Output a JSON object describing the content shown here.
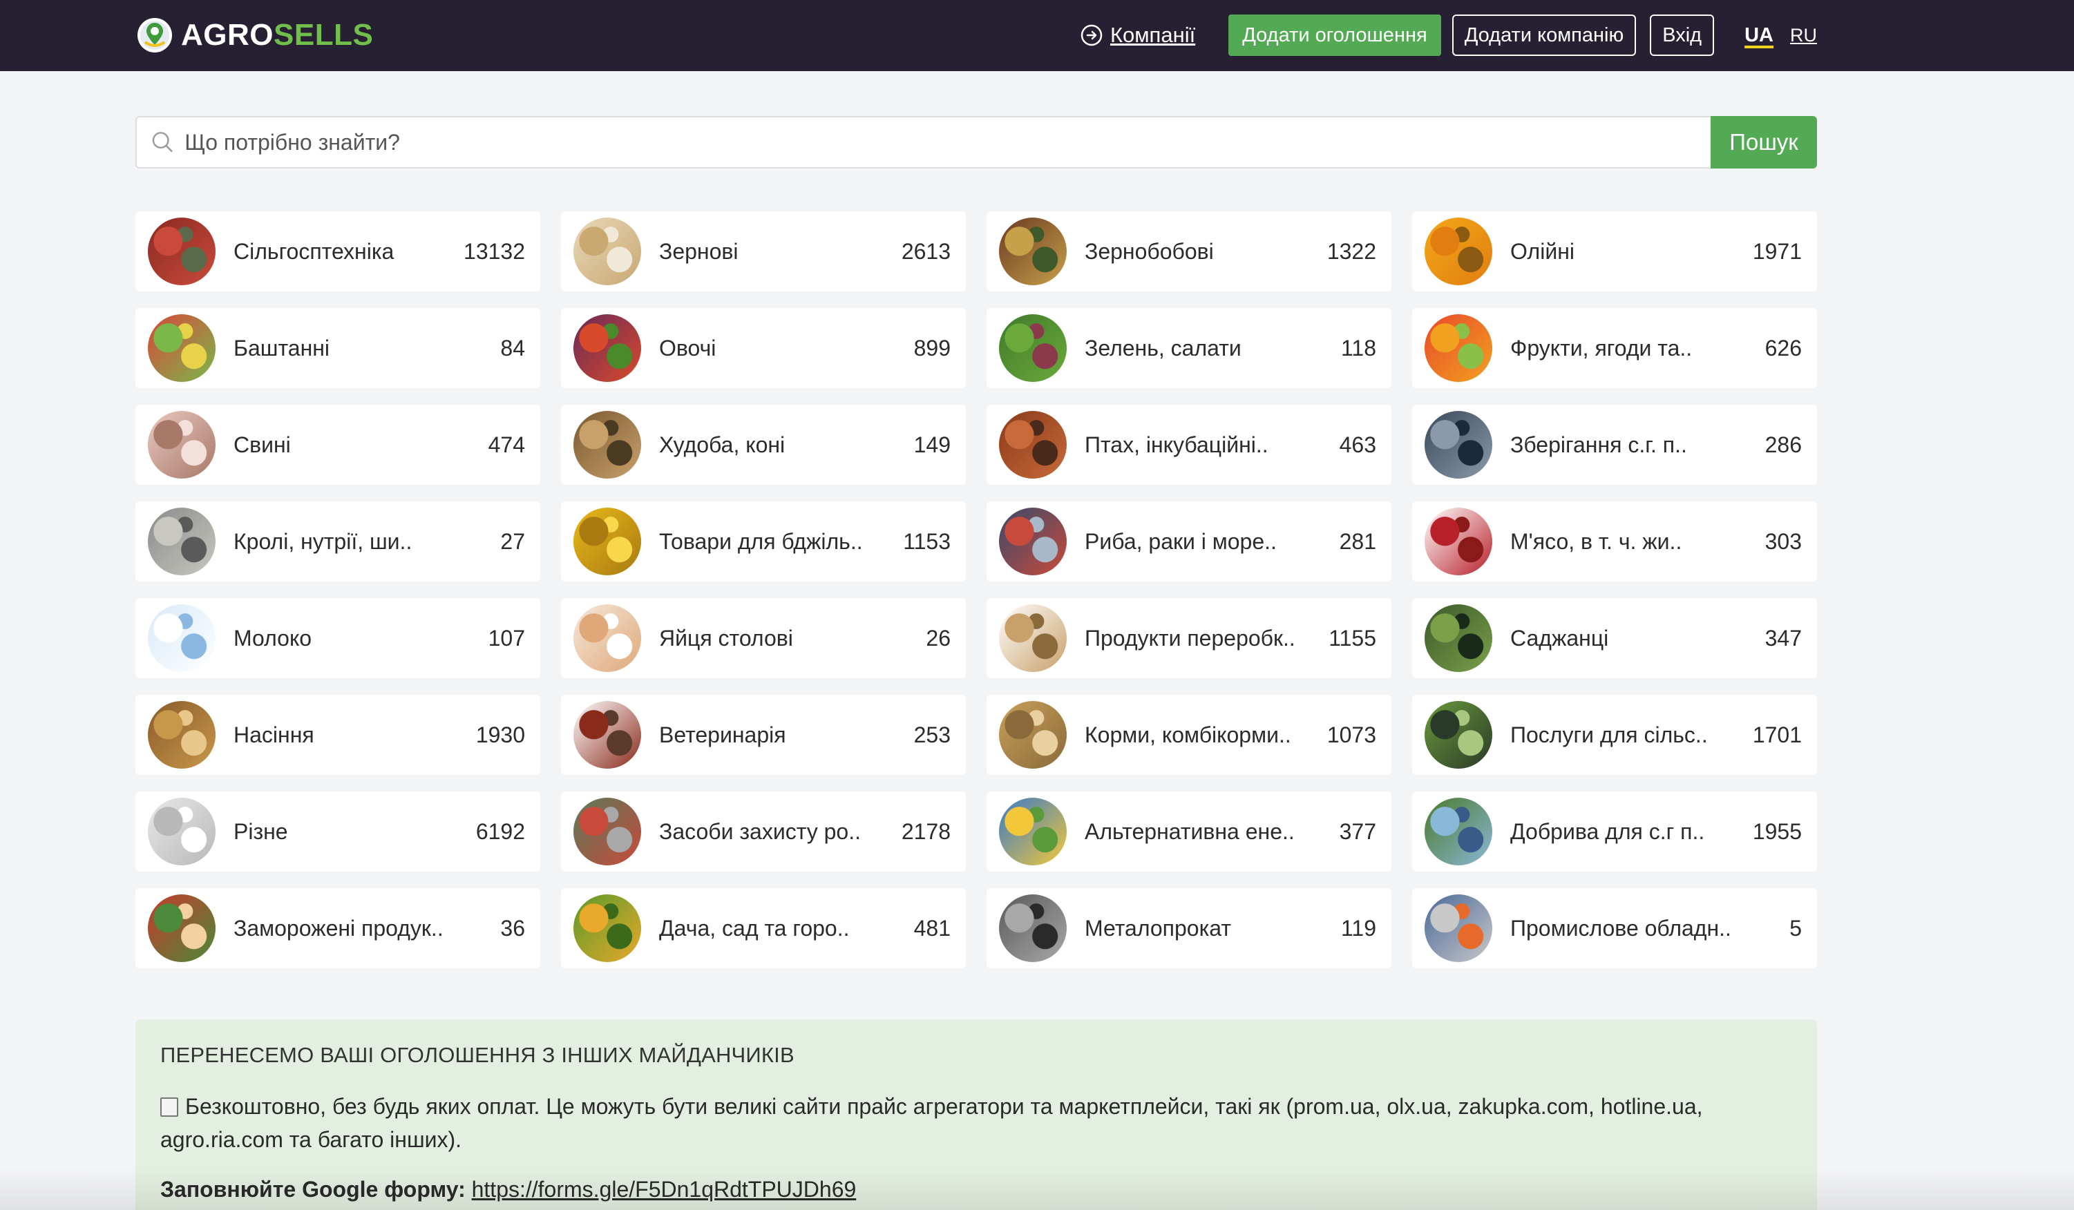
{
  "header": {
    "logo_part1": "AGRO",
    "logo_part2": "SELLS",
    "companies_link": "Компанії",
    "add_ad_button": "Додати оголошення",
    "add_company_button": "Додати компанію",
    "login_button": "Вхід",
    "lang_ua": "UA",
    "lang_ru": "RU"
  },
  "search": {
    "placeholder": "Що потрібно знайти?",
    "button": "Пошук"
  },
  "categories": [
    {
      "label": "Сільгосптехніка",
      "count": "13132",
      "colors": [
        "#8a2a22",
        "#c94a3a",
        "#5a6a4a"
      ]
    },
    {
      "label": "Зернові",
      "count": "2613",
      "colors": [
        "#e8d8b8",
        "#c9a872",
        "#f1e9d8"
      ]
    },
    {
      "label": "Зернобобові",
      "count": "1322",
      "colors": [
        "#6b3a22",
        "#c8a04a",
        "#3f5a2a"
      ]
    },
    {
      "label": "Олійні",
      "count": "1971",
      "colors": [
        "#f2a918",
        "#e27d10",
        "#8a5a12"
      ]
    },
    {
      "label": "Баштанні",
      "count": "84",
      "colors": [
        "#d8473a",
        "#7ab84a",
        "#e8d24a"
      ]
    },
    {
      "label": "Овочі",
      "count": "899",
      "colors": [
        "#6a2a5a",
        "#d84a2a",
        "#4a8a2a"
      ]
    },
    {
      "label": "Зелень, салати",
      "count": "118",
      "colors": [
        "#3f7a2a",
        "#6aaa3a",
        "#8a3a4a"
      ]
    },
    {
      "label": "Фрукти, ягоди та..",
      "count": "626",
      "colors": [
        "#e84a2a",
        "#f2a020",
        "#8ac04a"
      ]
    },
    {
      "label": "Свині",
      "count": "474",
      "colors": [
        "#e8c8c0",
        "#a87868",
        "#f4e0da"
      ]
    },
    {
      "label": "Худоба, коні",
      "count": "149",
      "colors": [
        "#7a5a32",
        "#c8a06a",
        "#4a3a22"
      ]
    },
    {
      "label": "Птах, інкубаційні..",
      "count": "463",
      "colors": [
        "#8a3a1a",
        "#c86a3a",
        "#4a2a1a"
      ]
    },
    {
      "label": "Зберігання с.г. п..",
      "count": "286",
      "colors": [
        "#3a4a5a",
        "#8a9aaa",
        "#1a2a3a"
      ]
    },
    {
      "label": "Кролі, нутрії, ши..",
      "count": "27",
      "colors": [
        "#8a8a8a",
        "#c8c8c0",
        "#5a5a5a"
      ]
    },
    {
      "label": "Товари для бджіль..",
      "count": "1153",
      "colors": [
        "#e8b81a",
        "#a87a10",
        "#f8d84a"
      ]
    },
    {
      "label": "Риба, раки і море..",
      "count": "281",
      "colors": [
        "#3a4a6a",
        "#c84a3a",
        "#a8b8c8"
      ]
    },
    {
      "label": "М'ясо, в т. ч. жи..",
      "count": "303",
      "colors": [
        "#ffffff",
        "#b8202a",
        "#8a1a1a"
      ]
    },
    {
      "label": "Молоко",
      "count": "107",
      "colors": [
        "#d8eaf8",
        "#ffffff",
        "#8ab8e0"
      ]
    },
    {
      "label": "Яйця столові",
      "count": "26",
      "colors": [
        "#f4e8dc",
        "#e0a878",
        "#ffffff"
      ]
    },
    {
      "label": "Продукти переробк..",
      "count": "1155",
      "colors": [
        "#ffffff",
        "#c8a06a",
        "#8a6a3a"
      ]
    },
    {
      "label": "Саджанці",
      "count": "347",
      "colors": [
        "#3a5a2a",
        "#7aa04a",
        "#1a2a1a"
      ]
    },
    {
      "label": "Насіння",
      "count": "1930",
      "colors": [
        "#8a5a2a",
        "#c8984a",
        "#e8c88a"
      ]
    },
    {
      "label": "Ветеринарія",
      "count": "253",
      "colors": [
        "#ffffff",
        "#8a2a1a",
        "#5a3a2a"
      ]
    },
    {
      "label": "Корми, комбікорми..",
      "count": "1073",
      "colors": [
        "#c8a05a",
        "#8a6a3a",
        "#e8d0a0"
      ]
    },
    {
      "label": "Послуги для сільс..",
      "count": "1701",
      "colors": [
        "#6a9a3a",
        "#2a3a2a",
        "#a8c880"
      ]
    },
    {
      "label": "Різне",
      "count": "6192",
      "colors": [
        "#e8e8e8",
        "#b8b8b8",
        "#ffffff"
      ]
    },
    {
      "label": "Засоби захисту ро..",
      "count": "2178",
      "colors": [
        "#5a7a5a",
        "#c84a3a",
        "#a8a8a8"
      ]
    },
    {
      "label": "Альтернативна ене..",
      "count": "377",
      "colors": [
        "#3a7ac8",
        "#f2c83a",
        "#5a9a3a"
      ]
    },
    {
      "label": "Добрива для с.г п..",
      "count": "1955",
      "colors": [
        "#4a7a2a",
        "#8ab8d8",
        "#3a5a8a"
      ]
    },
    {
      "label": "Заморожені продук..",
      "count": "36",
      "colors": [
        "#c83a2a",
        "#4a8a3a",
        "#f2d0a0"
      ]
    },
    {
      "label": "Дача, сад та горо..",
      "count": "481",
      "colors": [
        "#5a9a2a",
        "#e8a82a",
        "#3a6a1a"
      ]
    },
    {
      "label": "Металопрокат",
      "count": "119",
      "colors": [
        "#5a5a5a",
        "#a8a8a8",
        "#2a2a2a"
      ]
    },
    {
      "label": "Промислове обладн..",
      "count": "5",
      "colors": [
        "#4a6a9a",
        "#c8c8c8",
        "#e86a2a"
      ]
    }
  ],
  "info": {
    "title": "ПЕРЕНЕСЕМО ВАШІ ОГОЛОШЕННЯ З ІНШИХ МАЙДАНЧИКІВ",
    "text": "Безкоштовно, без будь яких оплат. Це можуть бути великі сайти прайс агрегатори та маркетплейси, такі як (prom.ua, olx.ua, zakupka.com, hotline.ua, agro.ria.com та багато інших).",
    "form_label": "Заповнюйте Google форму:",
    "form_link": "https://forms.gle/F5Dn1qRdtTPUJDh69"
  }
}
